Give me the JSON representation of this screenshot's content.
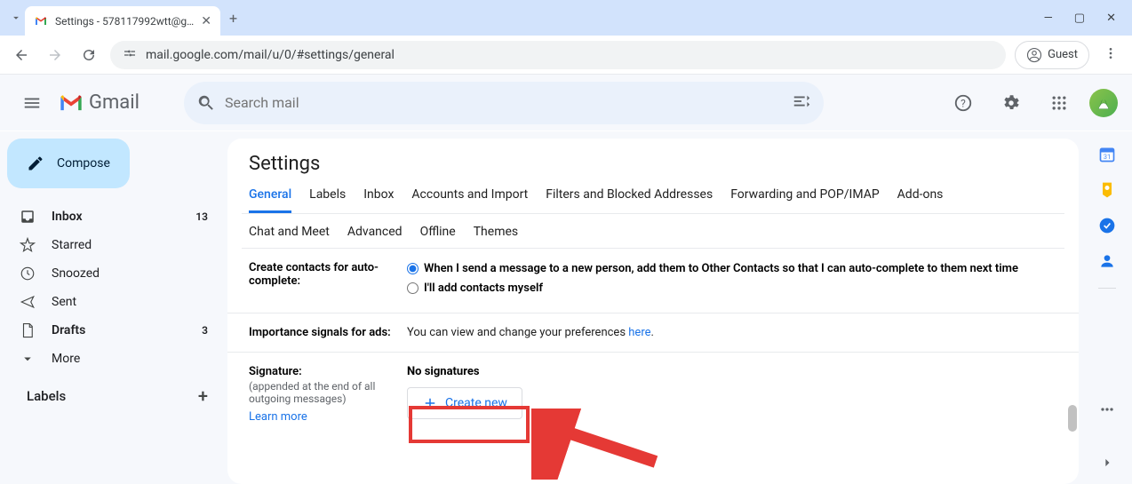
{
  "browser": {
    "tab_title": "Settings - 578117992wtt@gm",
    "url": "mail.google.com/mail/u/0/#settings/general",
    "guest_label": "Guest"
  },
  "header": {
    "app_name": "Gmail",
    "search_placeholder": "Search mail"
  },
  "compose_label": "Compose",
  "sidebar": {
    "items": [
      {
        "label": "Inbox",
        "count": "13"
      },
      {
        "label": "Starred",
        "count": ""
      },
      {
        "label": "Snoozed",
        "count": ""
      },
      {
        "label": "Sent",
        "count": ""
      },
      {
        "label": "Drafts",
        "count": "3"
      },
      {
        "label": "More",
        "count": ""
      }
    ],
    "labels_title": "Labels"
  },
  "settings": {
    "title": "Settings",
    "tabs_row1": [
      "General",
      "Labels",
      "Inbox",
      "Accounts and Import",
      "Filters and Blocked Addresses",
      "Forwarding and POP/IMAP",
      "Add-ons"
    ],
    "tabs_row2": [
      "Chat and Meet",
      "Advanced",
      "Offline",
      "Themes"
    ],
    "rows": {
      "contacts": {
        "label": "Create contacts for auto-complete:",
        "opt1": "When I send a message to a new person, add them to Other Contacts so that I can auto-complete to them next time",
        "opt2": "I'll add contacts myself"
      },
      "ads": {
        "label": "Importance signals for ads:",
        "text_pre": "You can view and change your preferences ",
        "link": "here",
        "text_post": "."
      },
      "signature": {
        "label": "Signature:",
        "sub": "(appended at the end of all outgoing messages)",
        "learn_more": "Learn more",
        "no_sig": "No signatures",
        "create_new": "Create new"
      }
    }
  }
}
